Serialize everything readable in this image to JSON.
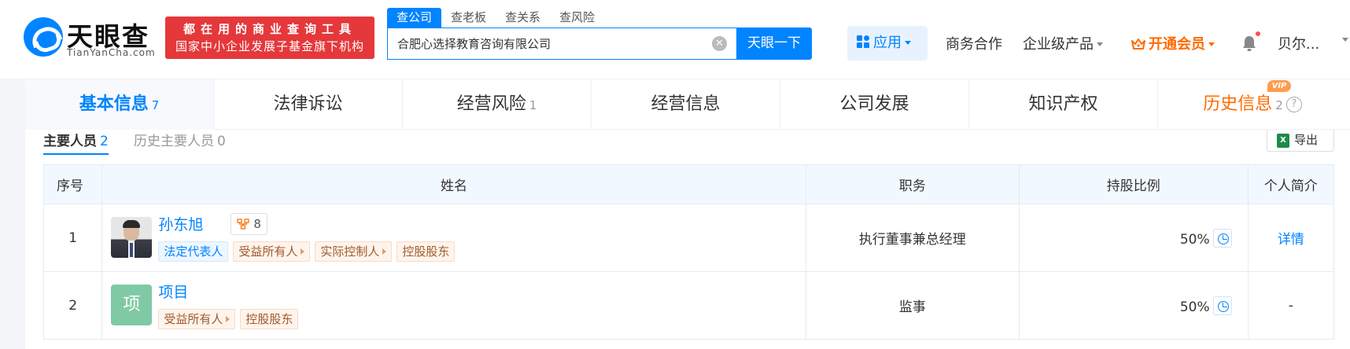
{
  "header": {
    "logo_cn": "天眼查",
    "logo_en": "TianYanCha.com",
    "slogan_line1": "都在用的商业查询工具",
    "slogan_line2": "国家中小企业发展子基金旗下机构",
    "search_tabs": [
      "查公司",
      "查老板",
      "查关系",
      "查风险"
    ],
    "search_value": "合肥心选择教育咨询有限公司",
    "search_button": "天眼一下",
    "nav": {
      "app": "应用",
      "business": "商务合作",
      "enterprise": "企业级产品",
      "vip": "开通会员",
      "user": "贝尔..."
    }
  },
  "tabs": [
    {
      "label": "基本信息",
      "count": "7"
    },
    {
      "label": "法律诉讼",
      "count": ""
    },
    {
      "label": "经营风险",
      "count": "1"
    },
    {
      "label": "经营信息",
      "count": ""
    },
    {
      "label": "公司发展",
      "count": ""
    },
    {
      "label": "知识产权",
      "count": ""
    },
    {
      "label": "历史信息",
      "count": "2"
    }
  ],
  "vip_tag": "VIP",
  "section": {
    "subtab_active": "主要人员",
    "subtab_active_count": "2",
    "subtab_inactive": "历史主要人员",
    "subtab_inactive_count": "0",
    "export_label": "导出",
    "excel_glyph": "X"
  },
  "table": {
    "headers": [
      "序号",
      "姓名",
      "职务",
      "持股比例",
      "个人简介"
    ],
    "rows": [
      {
        "index": "1",
        "name": "孙东旭",
        "relation_count": "8",
        "tags": [
          "法定代表人",
          "受益所有人",
          "实际控制人",
          "控股股东"
        ],
        "position": "执行董事兼总经理",
        "share": "50%",
        "intro": "详情"
      },
      {
        "index": "2",
        "name": "项目",
        "avatar_text": "项",
        "tags": [
          "受益所有人",
          "控股股东"
        ],
        "position": "监事",
        "share": "50%",
        "intro": "-"
      }
    ]
  },
  "colors": {
    "primary": "#0084ff",
    "vip": "#ff6b00",
    "slogan_bg": "#e5383b"
  }
}
